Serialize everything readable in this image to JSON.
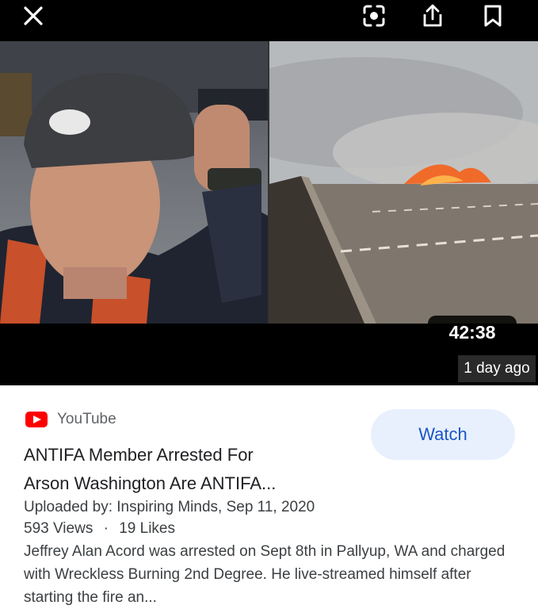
{
  "topbar": {
    "close_icon": "close-icon",
    "lens_icon": "lens-icon",
    "share_icon": "share-icon",
    "bookmark_icon": "bookmark-icon"
  },
  "video": {
    "duration": "42:38",
    "age": "1 day ago"
  },
  "result": {
    "source": "YouTube",
    "title_line1": "ANTIFA Member Arrested For",
    "title_line2": "Arson Washington Are ANTIFA...",
    "uploaded_by": "Uploaded by: Inspiring Minds, Sep 11, 2020",
    "views": "593 Views",
    "separator": "·",
    "likes": "19 Likes",
    "description": "Jeffrey Alan Acord was arrested on Sept 8th in Pallyup, WA and charged with Wreckless Burning 2nd Degree. He live-streamed himself after starting the fire an...",
    "watch_label": "Watch"
  },
  "colors": {
    "accent": "#1a56c4",
    "watch_bg": "#e8f0fe",
    "youtube_red": "#ff0000"
  }
}
